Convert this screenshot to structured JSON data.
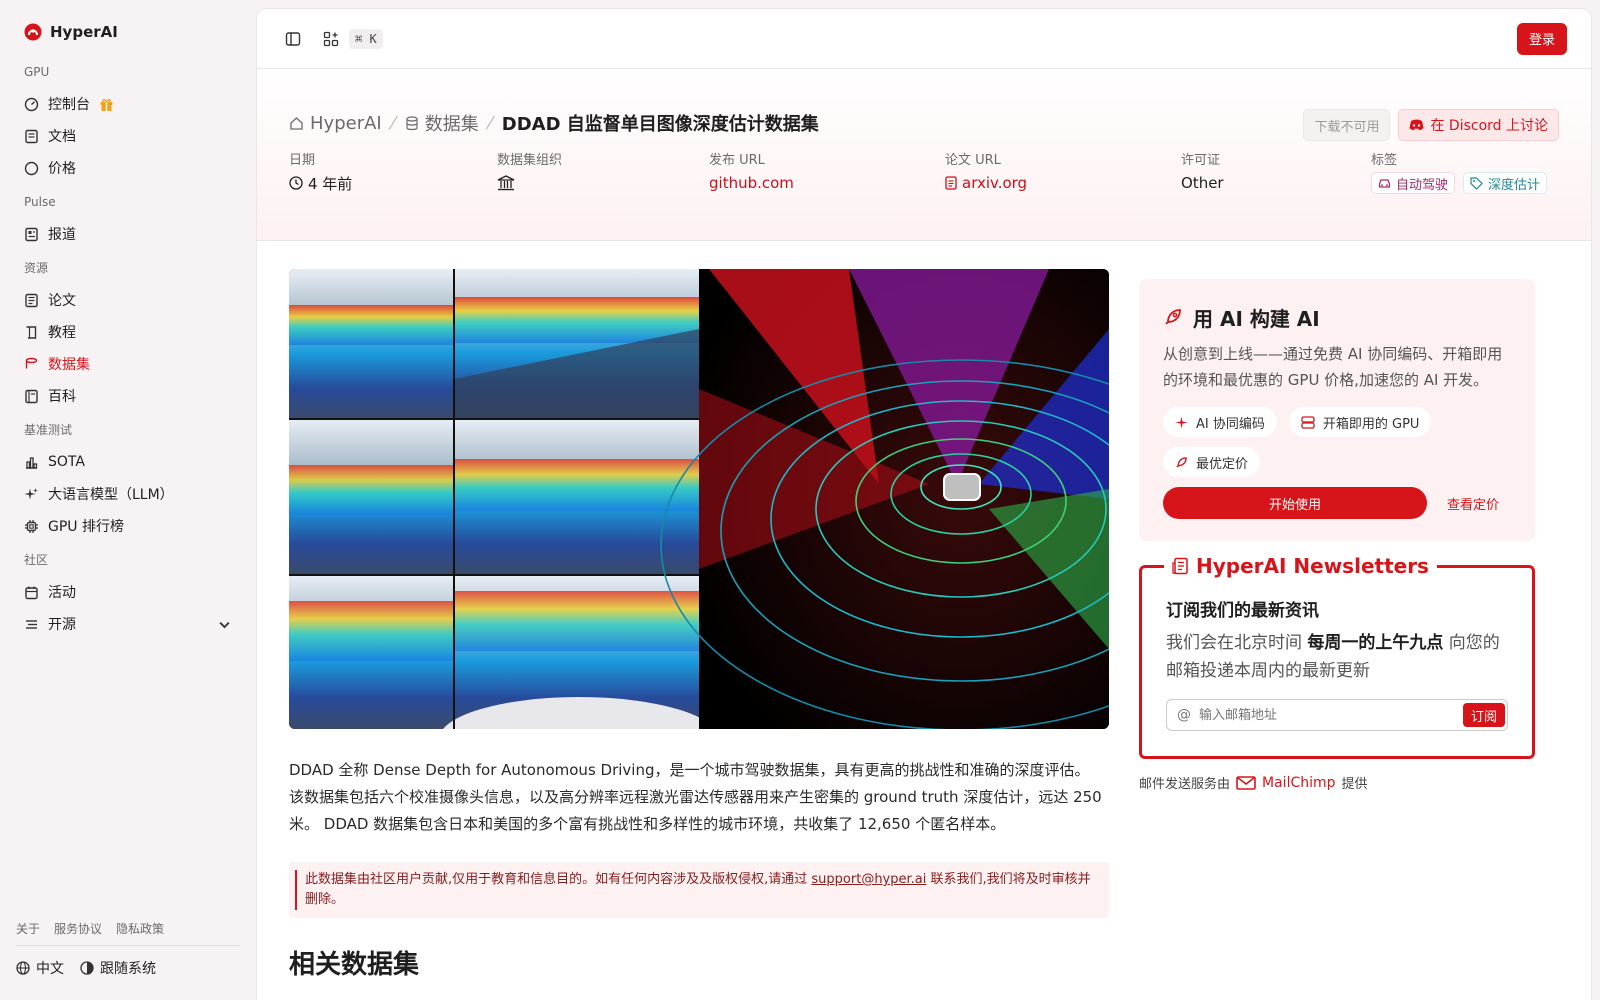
{
  "brand": {
    "name": "HyperAI"
  },
  "sidebar": {
    "sections": [
      {
        "title": "GPU",
        "items": [
          {
            "label": "控制台",
            "icon": "gauge-icon"
          },
          {
            "label": "文档",
            "icon": "doc-icon"
          },
          {
            "label": "价格",
            "icon": "dollar-icon"
          }
        ]
      },
      {
        "title": "Pulse",
        "items": [
          {
            "label": "报道",
            "icon": "news-icon"
          }
        ]
      },
      {
        "title": "资源",
        "items": [
          {
            "label": "论文",
            "icon": "paper-icon"
          },
          {
            "label": "教程",
            "icon": "book-icon"
          },
          {
            "label": "数据集",
            "icon": "database-icon",
            "active": true
          },
          {
            "label": "百科",
            "icon": "wiki-icon"
          }
        ]
      },
      {
        "title": "基准测试",
        "items": [
          {
            "label": "SOTA",
            "icon": "chart-icon"
          },
          {
            "label": "大语言模型（LLM）",
            "icon": "sparkle-icon"
          },
          {
            "label": "GPU 排行榜",
            "icon": "cpu-icon"
          }
        ]
      },
      {
        "title": "社区",
        "items": [
          {
            "label": "活动",
            "icon": "calendar-icon"
          },
          {
            "label": "开源",
            "icon": "list-icon",
            "expandable": true
          }
        ]
      }
    ],
    "footer": {
      "links": [
        "关于",
        "服务协议",
        "隐私政策"
      ],
      "language": "中文",
      "theme": "跟随系统"
    }
  },
  "topbar": {
    "shortcut": "⌘ K",
    "login": "登录"
  },
  "breadcrumb": {
    "home": "HyperAI",
    "section": "数据集",
    "current": "DDAD 自监督单目图像深度估计数据集"
  },
  "actions": {
    "download": "下载不可用",
    "discord": "在 Discord 上讨论"
  },
  "meta": {
    "date_label": "日期",
    "date_value": "4 年前",
    "org_label": "数据集组织",
    "release_label": "发布 URL",
    "release_value": "github.com",
    "paper_label": "论文 URL",
    "paper_value": "arxiv.org",
    "license_label": "许可证",
    "license_value": "Other",
    "tags_label": "标签",
    "tags": [
      "自动驾驶",
      "深度估计"
    ]
  },
  "description": "DDAD 全称 Dense Depth for Autonomous Driving，是一个城市驾驶数据集，具有更高的挑战性和准确的深度评估。 该数据集包括六个校准摄像头信息，以及高分辨率远程激光雷达传感器用来产生密集的 ground truth 深度估计，远达 250 米。 DDAD 数据集包含日本和美国的多个富有挑战性和多样性的城市环境，共收集了 12,650 个匿名样本。",
  "notice": {
    "before": "此数据集由社区用户贡献,仅用于教育和信息目的。如有任何内容涉及及版权侵权,请通过 ",
    "email": "support@hyper.ai",
    "after": " 联系我们,我们将及时审核并删除。"
  },
  "related_title": "相关数据集",
  "promo": {
    "title": "用 AI 构建 AI",
    "body": "从创意到上线——通过免费 AI 协同编码、开箱即用的环境和最优惠的 GPU 价格,加速您的 AI 开发。",
    "chips": [
      "AI 协同编码",
      "开箱即用的 GPU",
      "最优定价"
    ],
    "start": "开始使用",
    "pricing": "查看定价"
  },
  "newsletter": {
    "title": "HyperAI Newsletters",
    "heading": "订阅我们的最新资讯",
    "body_before": "我们会在北京时间 ",
    "body_bold": "每周一的上午九点",
    "body_after": " 向您的邮箱投递本周内的最新更新",
    "placeholder": "输入邮箱地址",
    "subscribe": "订阅",
    "provider_before": "邮件发送服务由",
    "provider": "MailChimp",
    "provider_after": "提供"
  },
  "colors": {
    "accent": "#d8141b"
  }
}
